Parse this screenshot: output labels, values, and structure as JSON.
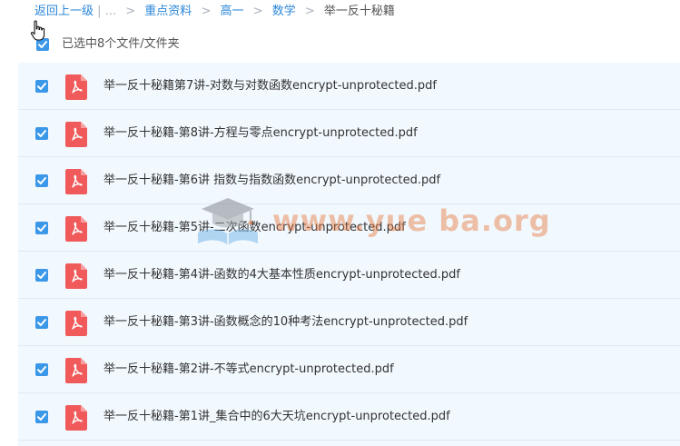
{
  "breadcrumb": {
    "back": "返回上一级",
    "divider": "|",
    "ellipsis": "...",
    "separator": ">",
    "crumbs": [
      "重点资料",
      "高一",
      "数学"
    ],
    "current": "举一反十秘籍"
  },
  "selection": {
    "label": "已选中8个文件/文件夹",
    "all_checked": true
  },
  "files": [
    {
      "name": "举一反十秘籍第7讲-对数与对数函数encrypt-unprotected.pdf",
      "checked": true,
      "type_icon": "pdf-icon"
    },
    {
      "name": "举一反十秘籍-第8讲-方程与零点encrypt-unprotected.pdf",
      "checked": true,
      "type_icon": "pdf-icon"
    },
    {
      "name": "举一反十秘籍-第6讲 指数与指数函数encrypt-unprotected.pdf",
      "checked": true,
      "type_icon": "pdf-icon"
    },
    {
      "name": "举一反十秘籍-第5讲-二次函数encrypt-unprotected.pdf",
      "checked": true,
      "type_icon": "pdf-icon"
    },
    {
      "name": "举一反十秘籍-第4讲-函数的4大基本性质encrypt-unprotected.pdf",
      "checked": true,
      "type_icon": "pdf-icon"
    },
    {
      "name": "举一反十秘籍-第3讲-函数概念的10种考法encrypt-unprotected.pdf",
      "checked": true,
      "type_icon": "pdf-icon"
    },
    {
      "name": "举一反十秘籍-第2讲-不等式encrypt-unprotected.pdf",
      "checked": true,
      "type_icon": "pdf-icon"
    },
    {
      "name": "举一反十秘籍-第1讲_集合中的6大天坑encrypt-unprotected.pdf",
      "checked": true,
      "type_icon": "pdf-icon"
    }
  ],
  "watermark": {
    "text": "www.yue ba.org",
    "icon": "graduation-cap-book-icon"
  },
  "colors": {
    "accent": "#3b97e8",
    "link": "#2b87d8",
    "list_background": "#f1f8fe",
    "pdf_red": "#f05a5a"
  }
}
